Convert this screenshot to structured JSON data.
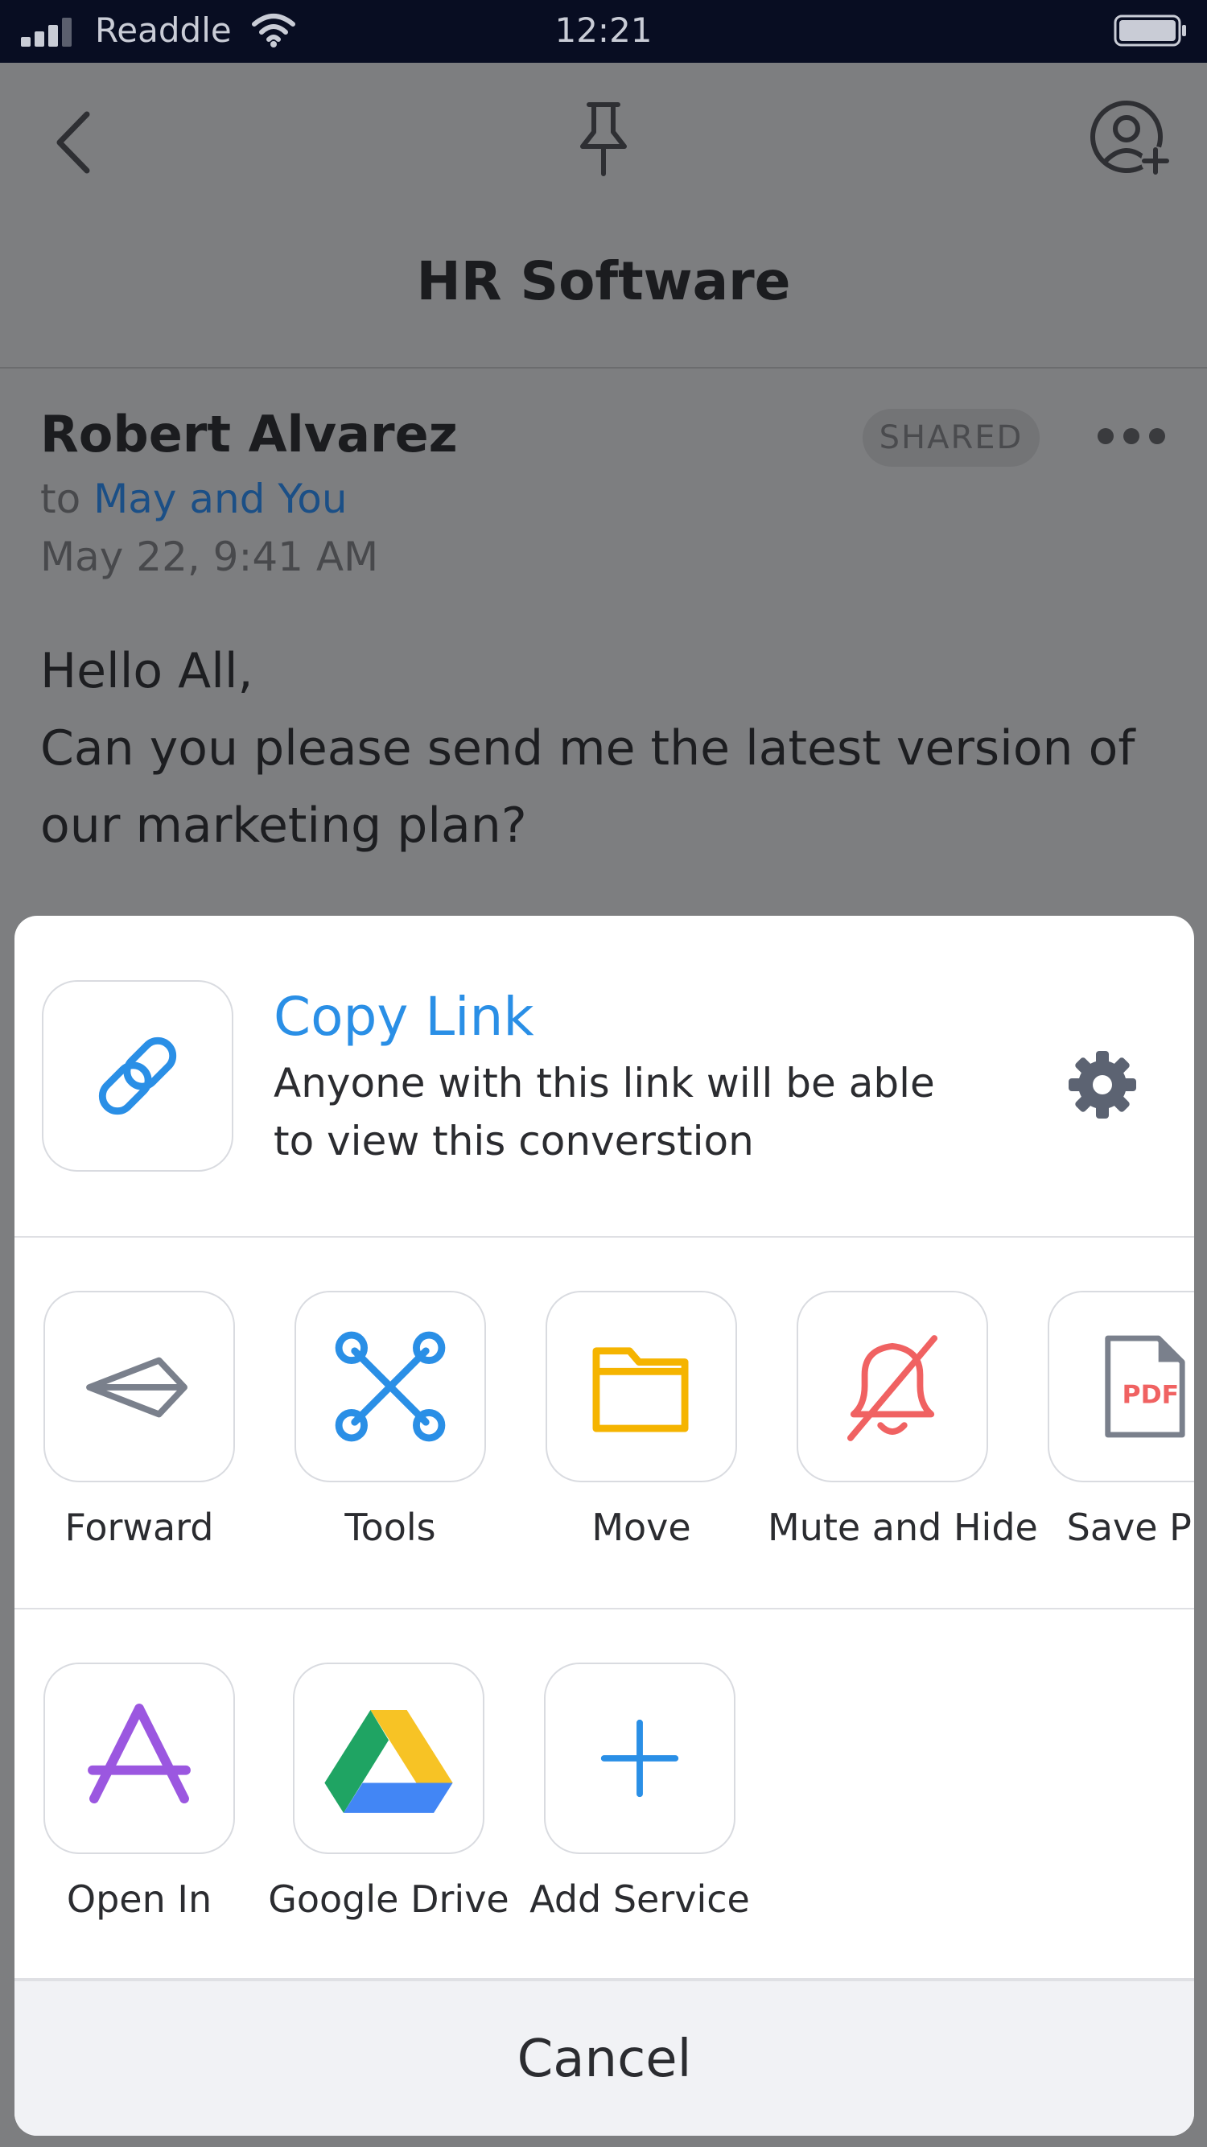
{
  "status_bar": {
    "carrier": "Readdle",
    "time": "12:21"
  },
  "header": {
    "title": "HR Software"
  },
  "message": {
    "sender": "Robert Alvarez",
    "badge": "SHARED",
    "to_prefix": "to",
    "recipients": "May and You",
    "date": "May 22, 9:41 AM",
    "body_line1": "Hello All,",
    "body_line2": "Can you please send me the latest version of our marketing plan?"
  },
  "share_sheet": {
    "copy_link": {
      "title": "Copy Link",
      "description": "Anyone with this link will be able to view this converstion"
    },
    "actions": [
      {
        "label": "Forward",
        "icon": "forward-icon"
      },
      {
        "label": "Tools",
        "icon": "tools-icon"
      },
      {
        "label": "Move",
        "icon": "folder-icon"
      },
      {
        "label": "Mute and Hide",
        "icon": "bell-off-icon"
      },
      {
        "label": "Save PD",
        "icon": "pdf-icon",
        "icon_text": "PDF"
      }
    ],
    "services": [
      {
        "label": "Open In",
        "icon": "app-store-icon"
      },
      {
        "label": "Google Drive",
        "icon": "google-drive-icon"
      },
      {
        "label": "Add Service",
        "icon": "plus-icon"
      }
    ],
    "cancel_label": "Cancel"
  },
  "colors": {
    "accent": "#2a8fe6",
    "folder": "#f5b400",
    "mute": "#f06262",
    "open_in": "#9b57e0",
    "status_bar_bg": "#080d22",
    "overlay_bg": "#7d7e80"
  }
}
